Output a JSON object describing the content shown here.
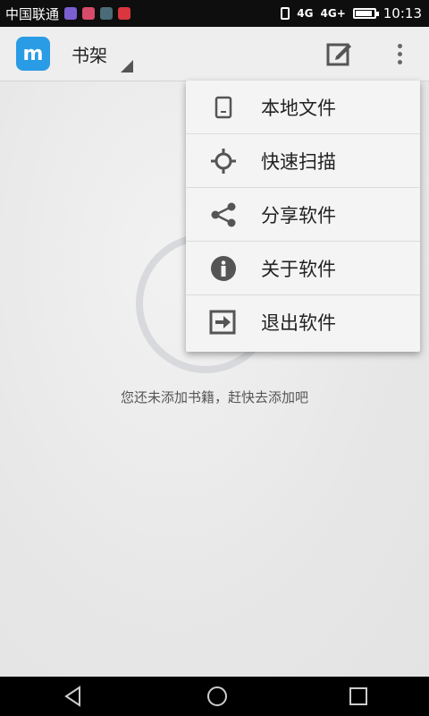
{
  "status_bar": {
    "carrier": "中国联通",
    "network": "4G",
    "network2": "4G+",
    "time": "10:13",
    "battery_level": 0.85,
    "app_icon_colors": [
      "#7b5fd1",
      "#d64b6a",
      "#4a6b78",
      "#d9363e"
    ]
  },
  "app_bar": {
    "logo_icon": "m-book-logo-icon",
    "title": "书架",
    "actions": [
      "edit-icon",
      "more-vert-icon"
    ]
  },
  "menu": {
    "items": [
      {
        "label": "本地文件",
        "icon": "phone-file-icon"
      },
      {
        "label": "快速扫描",
        "icon": "target-scan-icon"
      },
      {
        "label": "分享软件",
        "icon": "share-icon"
      },
      {
        "label": "关于软件",
        "icon": "info-icon"
      },
      {
        "label": "退出软件",
        "icon": "exit-icon"
      }
    ]
  },
  "main": {
    "empty_message": "您还未添加书籍，赶快去添加吧"
  },
  "nav_bar": {
    "buttons": [
      "back",
      "home",
      "recents"
    ]
  },
  "colors": {
    "accent": "#2a9ce6",
    "icon_gray": "#555555"
  }
}
